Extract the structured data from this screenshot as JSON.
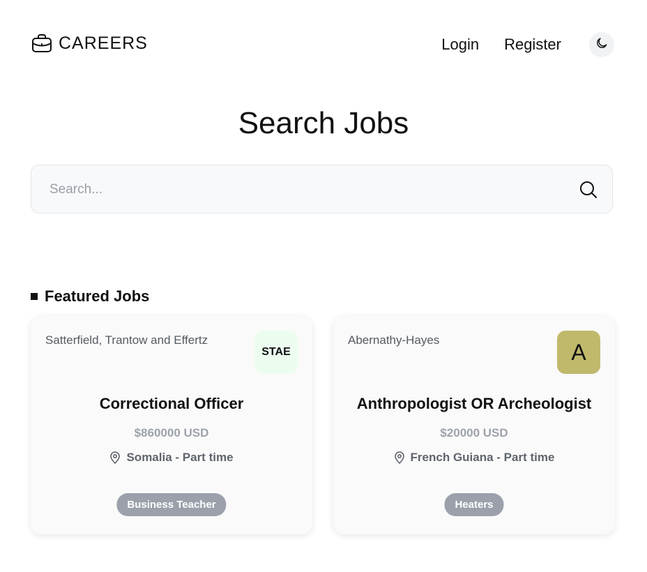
{
  "header": {
    "brand": "CAREERS",
    "brand_icon": "briefcase-icon",
    "login": "Login",
    "register": "Register",
    "theme_icon": "moon-icon"
  },
  "hero": {
    "title": "Search Jobs"
  },
  "search": {
    "placeholder": "Search...",
    "value": "",
    "icon": "search-icon"
  },
  "featured": {
    "title": "Featured Jobs",
    "jobs": [
      {
        "company": "Satterfield, Trantow and Effertz",
        "logo_text": "STAE",
        "logo_bg": "#ecfdf0",
        "title": "Correctional Officer",
        "salary": "$860000 USD",
        "location": "Somalia - Part time",
        "tag": "Business Teacher"
      },
      {
        "company": "Abernathy-Hayes",
        "logo_text": "A",
        "logo_bg": "#c0b96c",
        "title": "Anthropologist OR Archeologist",
        "salary": "$20000 USD",
        "location": "French Guiana - Part time",
        "tag": "Heaters"
      }
    ]
  },
  "colors": {
    "tag_bg": "#9ba0ab",
    "salary_text": "#9da2ab",
    "card_bg": "#fafafa"
  }
}
